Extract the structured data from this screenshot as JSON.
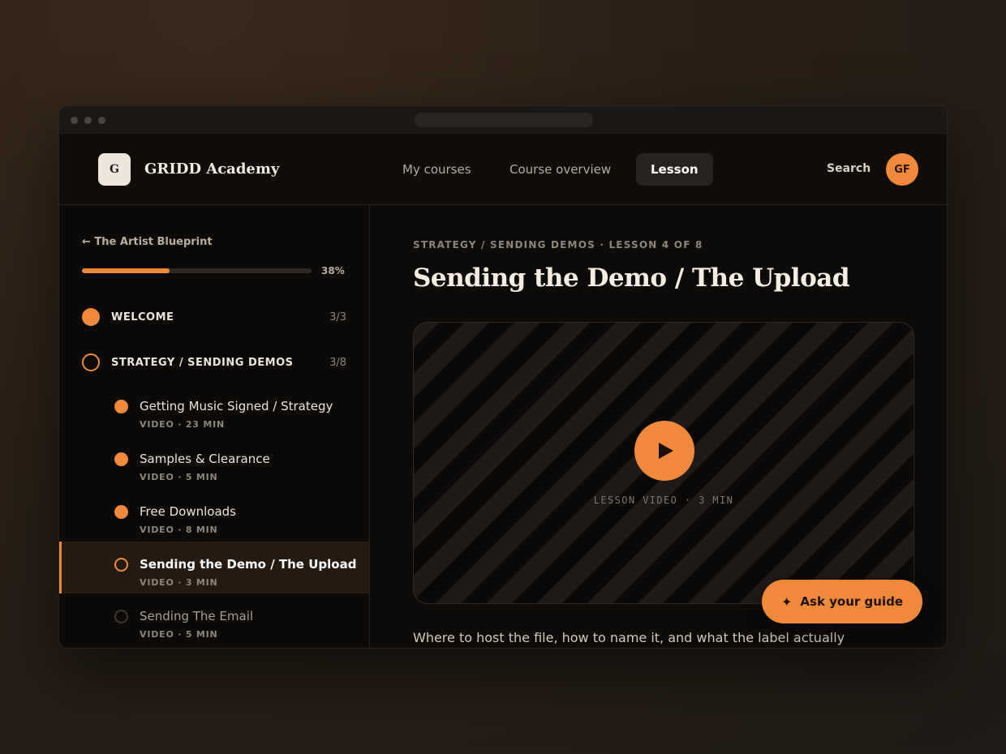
{
  "app": {
    "brand_initial": "G",
    "brand_name": "GRIDD Academy"
  },
  "nav": {
    "links": [
      {
        "label": "My courses",
        "active": false
      },
      {
        "label": "Course overview",
        "active": false
      },
      {
        "label": "Lesson",
        "active": true
      }
    ],
    "search_label": "Search",
    "avatar_initials": "GF"
  },
  "sidebar": {
    "back_label": "← The Artist Blueprint",
    "progress_percent": 38,
    "progress_label": "38%",
    "sections": [
      {
        "label": "WELCOME",
        "count": "3/3",
        "status": "complete"
      },
      {
        "label": "STRATEGY / SENDING DEMOS",
        "count": "3/8",
        "status": "in-progress"
      }
    ],
    "lessons": [
      {
        "title": "Getting Music Signed / Strategy",
        "meta": "VIDEO · 23 MIN",
        "status": "complete"
      },
      {
        "title": "Samples & Clearance",
        "meta": "VIDEO · 5 MIN",
        "status": "complete"
      },
      {
        "title": "Free Downloads",
        "meta": "VIDEO · 8 MIN",
        "status": "complete"
      },
      {
        "title": "Sending the Demo / The Upload",
        "meta": "VIDEO · 3 MIN",
        "status": "current"
      },
      {
        "title": "Sending The Email",
        "meta": "VIDEO · 5 MIN",
        "status": "not-started"
      }
    ]
  },
  "main": {
    "breadcrumb": "STRATEGY / SENDING DEMOS · LESSON 4 OF 8",
    "title": "Sending the Demo / The Upload",
    "video_label": "LESSON VIDEO · 3 MIN",
    "description": "Where to host the file, how to name it, and what the label actually"
  },
  "assistant": {
    "icon": "sparkle-icon",
    "label": "Ask your guide"
  },
  "colors": {
    "accent": "#f08a3a",
    "background": "#0d0b09",
    "text": "#f5ede2"
  }
}
